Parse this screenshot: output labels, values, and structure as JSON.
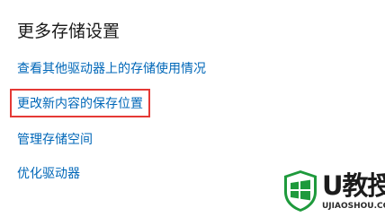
{
  "section": {
    "title": "更多存储设置"
  },
  "links": [
    {
      "label": "查看其他驱动器上的存储使用情况"
    },
    {
      "label": "更改新内容的保存位置"
    },
    {
      "label": "管理存储空间"
    },
    {
      "label": "优化驱动器"
    }
  ],
  "highlight": {
    "color": "#e53935",
    "target": "更改新内容的保存位置"
  },
  "watermark": {
    "brand": "U教授",
    "url": "UJIAOSHOU.COM",
    "logo_icon": "windows-shield-logo",
    "logo_color": "#1e9a3c"
  },
  "colors": {
    "link": "#0067b8",
    "title": "#1a1a1a",
    "background": "#ffffff"
  }
}
